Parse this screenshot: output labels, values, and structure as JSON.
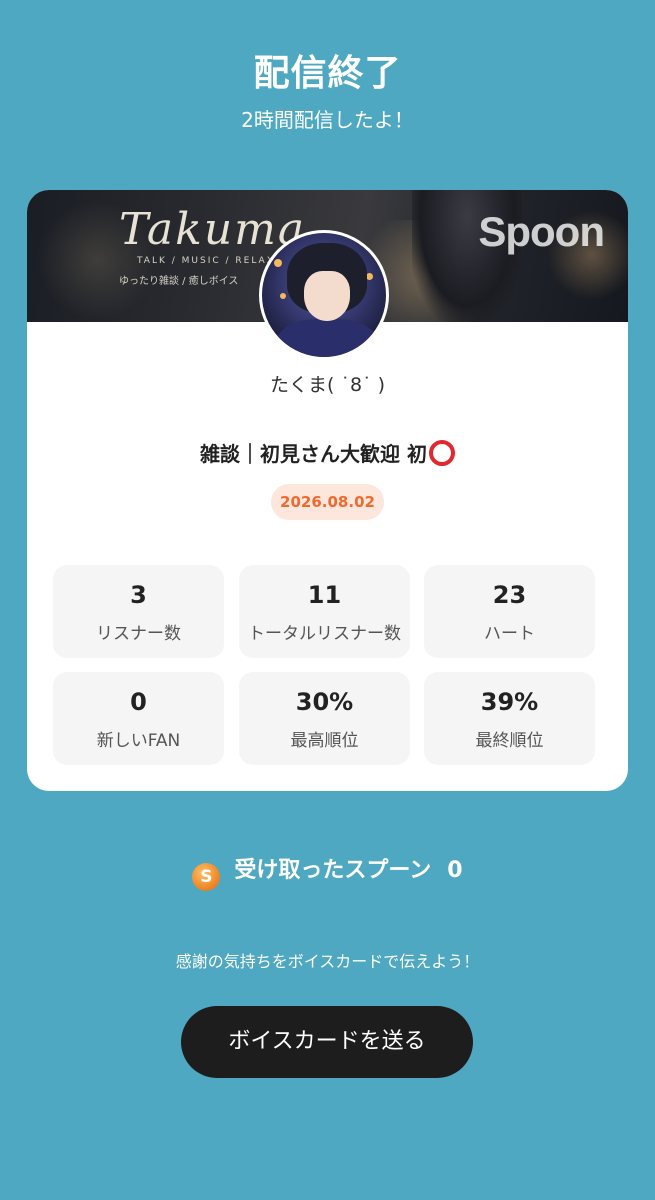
{
  "header": {
    "title": "配信終了",
    "subtitle": "2時間配信したよ！"
  },
  "card": {
    "banner": {
      "name": "Takuma",
      "tagline": "TALK / MUSIC / RELAX",
      "subline": "ゆったり雑談 / 癒しボイス",
      "brand": "Spoon"
    },
    "username": "たくま( ˙8˙ )",
    "broadcast_title": "雑談｜初見さん大歓迎 初",
    "date": "2026.08.02",
    "stats": [
      {
        "value": "3",
        "label": "リスナー数"
      },
      {
        "value": "11",
        "label": "トータルリスナー数"
      },
      {
        "value": "23",
        "label": "ハート"
      },
      {
        "value": "0",
        "label": "新しいFAN"
      },
      {
        "value": "30%",
        "label": "最高順位"
      },
      {
        "value": "39%",
        "label": "最終順位"
      }
    ]
  },
  "spoons": {
    "icon_letter": "S",
    "label": "受け取ったスプーン",
    "count": "0"
  },
  "thanks_text": "感謝の気持ちをボイスカードで伝えよう！",
  "voice_card_button": "ボイスカードを送る",
  "colors": {
    "background": "#4fa8c1",
    "date_badge_bg": "#fde7dc",
    "date_badge_text": "#f06a2f",
    "button_bg": "#1d1d1d"
  }
}
